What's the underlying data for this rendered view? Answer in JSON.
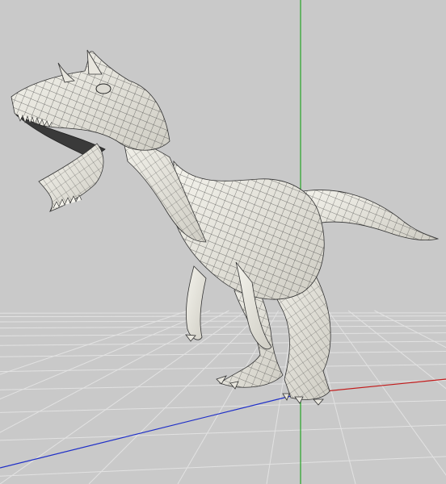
{
  "viewport": {
    "background": "#c9c9c9",
    "grid_color": "#e2e2e2",
    "mesh_fill": "#ecebe3",
    "wire_color": "#2f2f2f",
    "axes": {
      "x_color": "#c21b1b",
      "y_color": "#25a425",
      "z_color": "#1f2fc8"
    },
    "model_icon": "dinosaur-wireframe-mesh"
  }
}
